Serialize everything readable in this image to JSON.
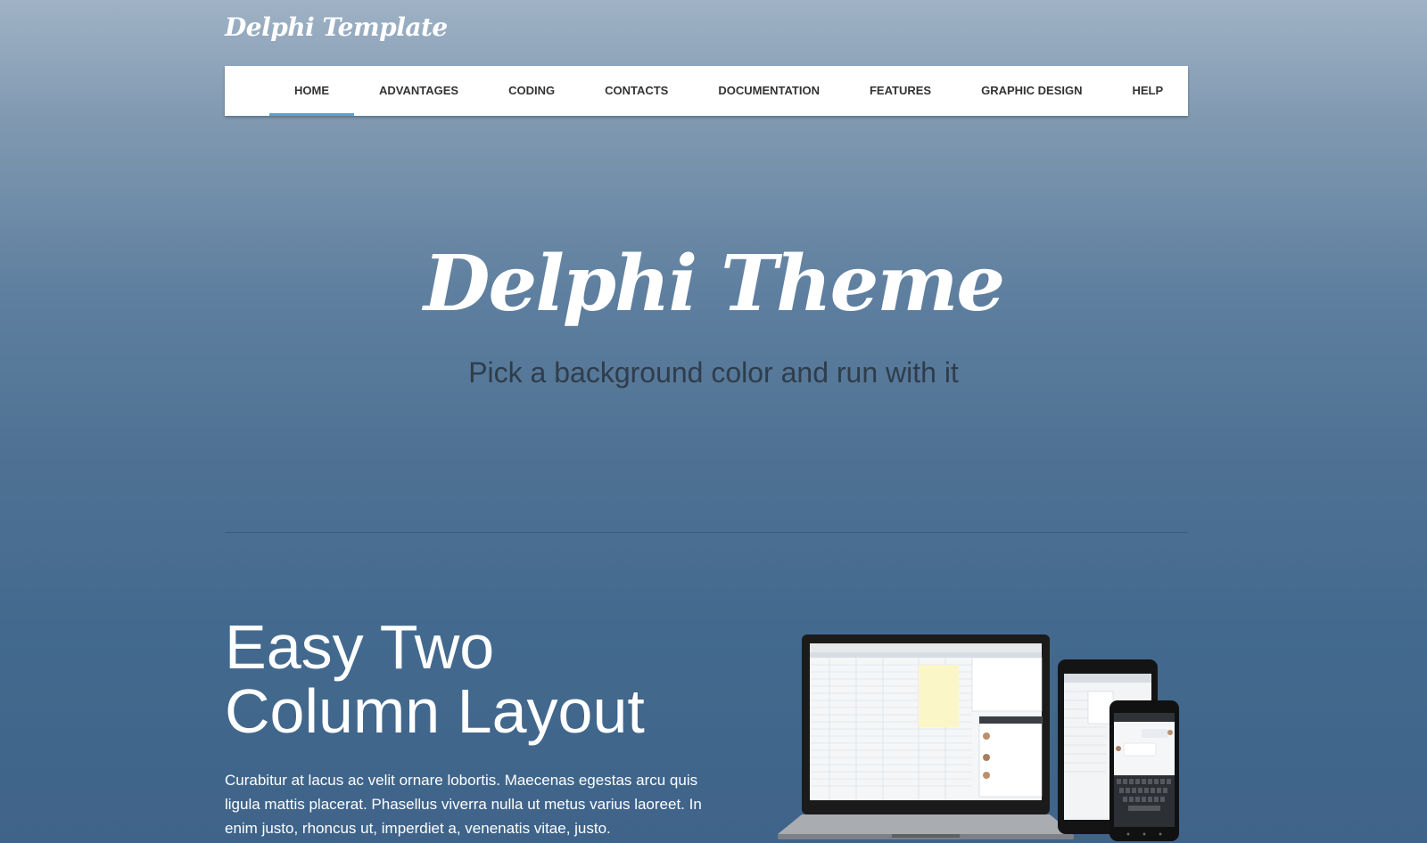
{
  "brand": {
    "name": "Delphi Template"
  },
  "nav": {
    "items": [
      {
        "label": "HOME",
        "active": true
      },
      {
        "label": "ADVANTAGES"
      },
      {
        "label": "CODING"
      },
      {
        "label": "CONTACTS"
      },
      {
        "label": "DOCUMENTATION"
      },
      {
        "label": "FEATURES"
      },
      {
        "label": "GRAPHIC DESIGN"
      },
      {
        "label": "HELP"
      }
    ]
  },
  "hero": {
    "title": "Delphi Theme",
    "subtitle": "Pick a background color and run with it"
  },
  "section": {
    "heading_line1": "Easy Two",
    "heading_line2": "Column Layout",
    "text": "Curabitur at lacus ac velit ornare lobortis. Maecenas egestas arcu quis ligula mattis placerat. Phasellus viverra nulla ut metus varius laoreet. In enim justo, rhoncus ut, imperdiet a, venenatis vitae, justo."
  },
  "colors": {
    "accent": "#5aa3d9",
    "nav_bg": "#ffffff",
    "bg_top": "#9fb2c5",
    "bg_bottom": "#3f6389"
  },
  "image": {
    "icon": "devices-illustration"
  }
}
